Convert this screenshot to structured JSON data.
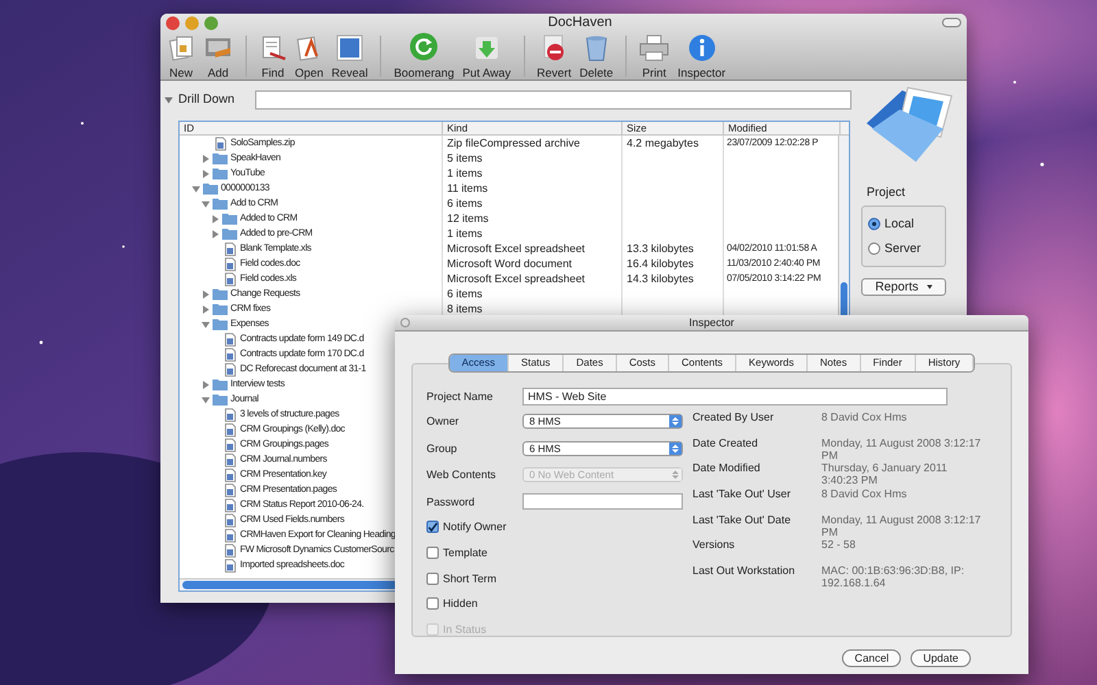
{
  "window": {
    "title": "DocHaven"
  },
  "toolbar_groups": [
    {
      "items": [
        {
          "label": "New"
        },
        {
          "label": "Add"
        }
      ]
    },
    {
      "items": [
        {
          "label": "Find"
        },
        {
          "label": "Open"
        },
        {
          "label": "Reveal"
        }
      ]
    },
    {
      "items": [
        {
          "label": "Boomerang"
        },
        {
          "label": "Put Away"
        }
      ]
    },
    {
      "items": [
        {
          "label": "Revert"
        },
        {
          "label": "Delete"
        }
      ]
    },
    {
      "items": [
        {
          "label": "Print"
        },
        {
          "label": "Inspector"
        }
      ]
    }
  ],
  "drill_down": {
    "label": "Drill Down",
    "expanded": true
  },
  "table": {
    "columns": [
      "ID",
      "Kind",
      "Size",
      "Modified"
    ],
    "rows": [
      {
        "children": [
          {
            "name": "SoloSamples.zip",
            "kind": "Zip fileCompressed archive",
            "size": "4.2 megabytes",
            "modified": "23/07/2009 12:02:28 P"
          },
          {
            "name": "SpeakHaven",
            "kind": "5 items",
            "expanded": false
          },
          {
            "name": "YouTube",
            "kind": "1 items",
            "expanded": false
          }
        ]
      },
      {
        "name": "0000000133",
        "kind": "11 items",
        "expanded": true,
        "children": [
          {
            "name": "Add to CRM",
            "kind": "6 items",
            "expanded": true,
            "children": [
              {
                "name": "Added to CRM",
                "kind": "12 items",
                "expanded": false
              },
              {
                "name": "Added to pre-CRM",
                "kind": "1 items",
                "expanded": false
              },
              {
                "name": "Blank Template.xls",
                "kind": "Microsoft Excel spreadsheet",
                "size": "13.3 kilobytes",
                "modified": "04/02/2010 11:01:58 A"
              },
              {
                "name": "Field codes.doc",
                "kind": "Microsoft Word document",
                "size": "16.4 kilobytes",
                "modified": "11/03/2010 2:40:40 PM"
              },
              {
                "name": "Field codes.xls",
                "kind": "Microsoft Excel spreadsheet",
                "size": "14.3 kilobytes",
                "modified": "07/05/2010 3:14:22 PM"
              }
            ]
          },
          {
            "name": "Change Requests",
            "kind": "6 items",
            "expanded": false
          },
          {
            "name": "CRM fixes",
            "kind": "8 items",
            "expanded": false
          },
          {
            "name": "Expenses",
            "expanded": true,
            "children": [
              {
                "name": "Contracts update form 149 DC.d"
              },
              {
                "name": "Contracts update form 170 DC.d"
              },
              {
                "name": "DC Reforecast document at 31-1"
              }
            ]
          },
          {
            "name": "Interview tests",
            "expanded": false
          },
          {
            "name": "Journal",
            "expanded": true,
            "children": [
              {
                "name": "3 levels of structure.pages"
              },
              {
                "name": "CRM Groupings (Kelly).doc"
              },
              {
                "name": "CRM Groupings.pages"
              },
              {
                "name": "CRM Journal.numbers"
              },
              {
                "name": "CRM Presentation.key"
              },
              {
                "name": "CRM Presentation.pages"
              },
              {
                "name": "CRM Status Report 2010-06-24."
              },
              {
                "name": "CRM Used Fields.numbers"
              },
              {
                "name": "CRMHaven Export for Cleaning Heading"
              },
              {
                "name": "FW Microsoft Dynamics CustomerSourc"
              },
              {
                "name": "Imported spreadsheets.doc"
              }
            ]
          }
        ]
      }
    ]
  },
  "project": {
    "title": "Project",
    "options": [
      {
        "label": "Local",
        "selected": true
      },
      {
        "label": "Server",
        "selected": false
      }
    ]
  },
  "reports_button": {
    "label": "Reports"
  },
  "inspector": {
    "title": "Inspector",
    "tabs": [
      {
        "label": "Access",
        "selected": true
      },
      {
        "label": "Status",
        "selected": false
      },
      {
        "label": "Dates",
        "selected": false
      },
      {
        "label": "Costs",
        "selected": false
      },
      {
        "label": "Contents",
        "selected": false
      },
      {
        "label": "Keywords",
        "selected": false
      },
      {
        "label": "Notes",
        "selected": false
      },
      {
        "label": "Finder",
        "selected": false
      },
      {
        "label": "History",
        "selected": false
      }
    ],
    "project_name": {
      "label": "Project Name",
      "value": "HMS - Web Site"
    },
    "popups": [
      {
        "label": "Owner",
        "value": "8 HMS",
        "disabled": false
      },
      {
        "label": "Group",
        "value": "6 HMS",
        "disabled": false
      },
      {
        "label": "Web Contents",
        "value": "0 No Web Content",
        "disabled": true
      }
    ],
    "password": {
      "label": "Password"
    },
    "checkboxes": [
      {
        "label": "Notify Owner",
        "checked": true,
        "disabled": false
      },
      {
        "label": "Template",
        "checked": false,
        "disabled": false
      },
      {
        "label": "Short Term",
        "checked": false,
        "disabled": false
      },
      {
        "label": "Hidden",
        "checked": false,
        "disabled": false
      },
      {
        "label": "In Status",
        "checked": false,
        "disabled": true
      }
    ],
    "info": [
      {
        "label": "Created By User",
        "value": "8 David Cox Hms"
      },
      {
        "label": "Date Created",
        "value": "Monday, 11 August 2008 3:12:17 PM"
      },
      {
        "label": "Date Modified",
        "value": "Thursday, 6 January 2011 3:40:23 PM"
      },
      {
        "label": "Last 'Take Out' User",
        "value": "8 David Cox Hms"
      },
      {
        "label": "Last 'Take Out' Date",
        "value": "Monday, 11 August 2008 3:12:17 PM"
      },
      {
        "label": "Versions",
        "value": "52 - 58"
      },
      {
        "label": "Last Out Workstation",
        "value": "MAC: 00:1B:63:96:3D:B8, IP: 192.168.1.64"
      }
    ],
    "buttons": [
      {
        "label": "Cancel"
      },
      {
        "label": "Update"
      }
    ]
  }
}
